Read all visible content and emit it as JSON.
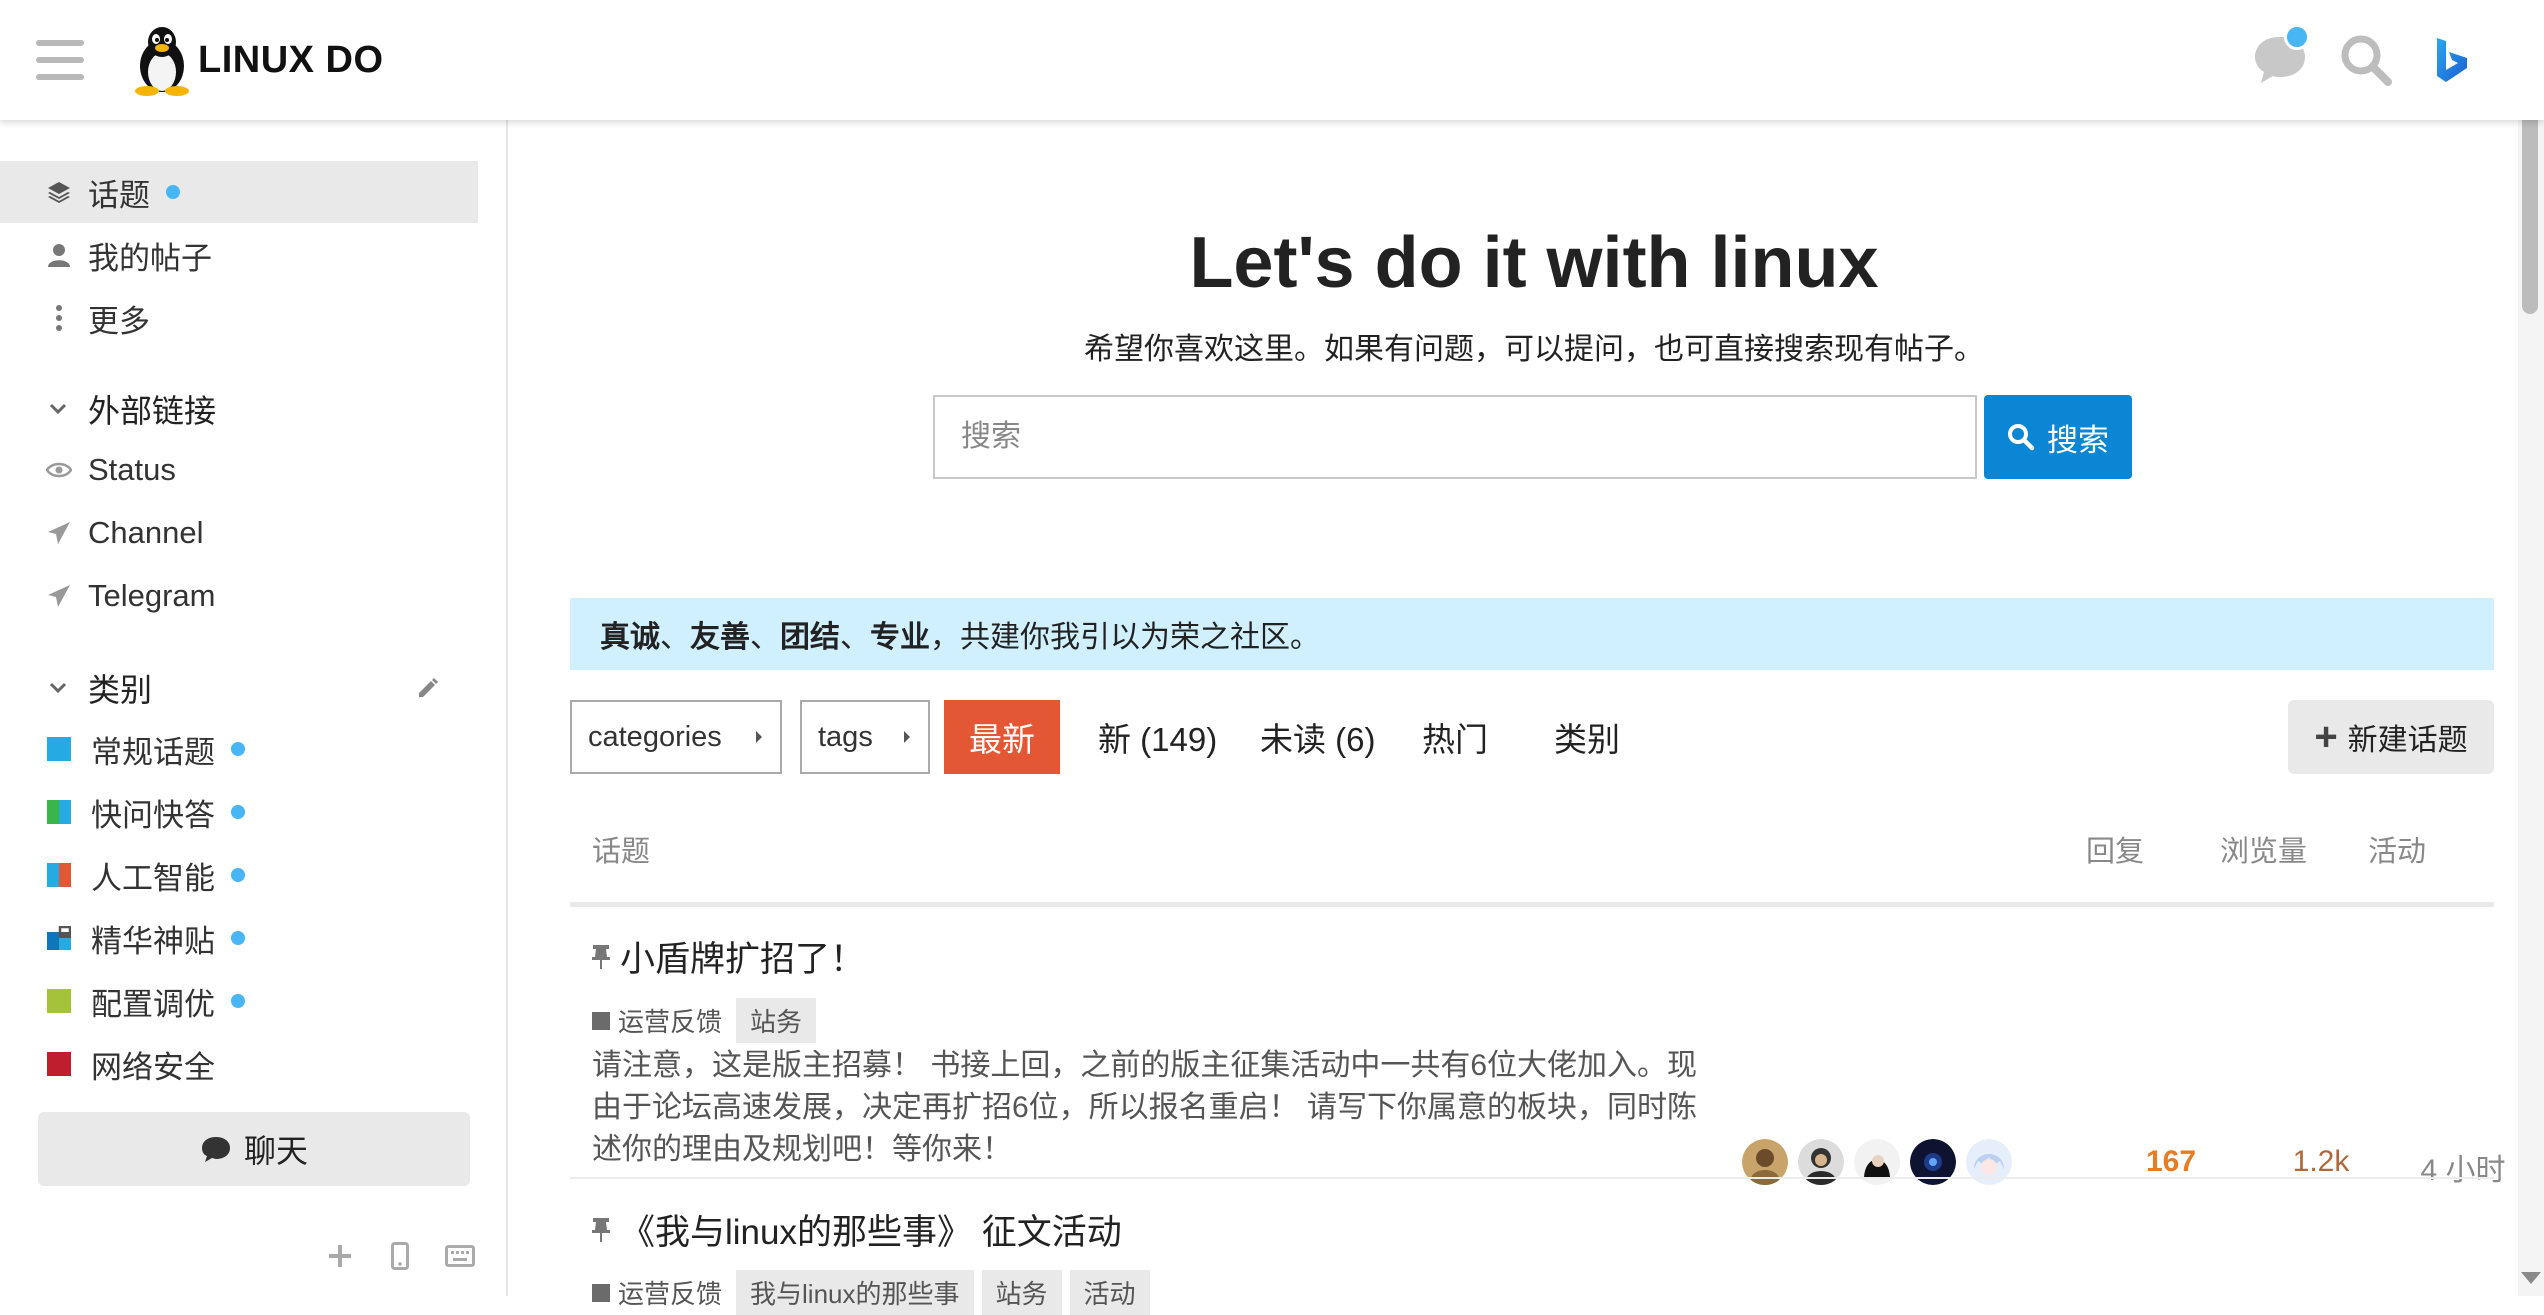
{
  "header": {
    "logo_text": "LINUX DO",
    "icons": [
      "menu-icon",
      "chat-icon",
      "search-icon",
      "bing-icon"
    ],
    "colors": {
      "notify_dot": "#48b5f5"
    }
  },
  "sidebar": {
    "nav": [
      {
        "label": "话题",
        "icon": "layers-icon",
        "dot": true,
        "active": true
      },
      {
        "label": "我的帖子",
        "icon": "user-icon"
      },
      {
        "label": "更多",
        "icon": "more-icon"
      }
    ],
    "links_title": "外部链接",
    "links": [
      {
        "label": "Status",
        "icon": "eye-icon"
      },
      {
        "label": "Channel",
        "icon": "send-icon"
      },
      {
        "label": "Telegram",
        "icon": "send-icon"
      }
    ],
    "categories_title": "类别",
    "categories": [
      {
        "label": "常规话题",
        "color": "#25aae1",
        "dot": true
      },
      {
        "label": "快问快答",
        "colors": [
          "#3ab54a",
          "#25aae1"
        ],
        "dot": true
      },
      {
        "label": "人工智能",
        "colors": [
          "#25aae1",
          "#e45735"
        ],
        "dot": true
      },
      {
        "label": "精华神贴",
        "colors": [
          "#0e76bd",
          "#25aae1"
        ],
        "locked": true,
        "dot": true
      },
      {
        "label": "配置调优",
        "color": "#a5c33a",
        "dot": true
      },
      {
        "label": "网络安全",
        "color": "#bf1e2e"
      }
    ],
    "chat_label": "聊天"
  },
  "main": {
    "hero_title": "Let's do it with linux",
    "hero_subtitle": "希望你喜欢这里。如果有问题，可以提问，也可直接搜索现有帖子。",
    "search": {
      "placeholder": "搜索",
      "button": "搜索"
    },
    "banner": {
      "bold_parts": [
        "真诚",
        "友善",
        "团结",
        "专业"
      ],
      "separator": "、",
      "rest": "，共建你我引以为荣之社区。"
    },
    "nav": {
      "categories_dd": "categories",
      "tags_dd": "tags",
      "tabs": [
        "最新",
        "新 (149)",
        "未读 (6)",
        "热门",
        "类别"
      ],
      "active_tab": "最新",
      "new_topic": "新建话题"
    },
    "table_headers": {
      "topic": "话题",
      "replies": "回复",
      "views": "浏览量",
      "activity": "活动"
    },
    "topics": [
      {
        "title": "小盾牌扩招了！",
        "pinned": true,
        "category": "运营反馈",
        "tags": [
          "站务"
        ],
        "excerpt": "请注意，这是版主招募！ 书接上回，之前的版主征集活动中一共有6位大佬加入。现由于论坛高速发展，决定再扩招6位，所以报名重启！ 请写下你属意的板块，同时陈述你的理由及规划吧！等你来！",
        "replies": "167",
        "views": "1.2k",
        "activity": "4 小时"
      },
      {
        "title": "《我与linux的那些事》 征文活动",
        "pinned": true,
        "category": "运营反馈",
        "tags": [
          "我与linux的那些事",
          "站务",
          "活动"
        ]
      }
    ],
    "colors": {
      "primary": "#0a86d4",
      "active_tab": "#e45735",
      "banner_bg": "#d1f0ff",
      "replies_hot": "#e67c23",
      "views": "#b0683a"
    }
  }
}
